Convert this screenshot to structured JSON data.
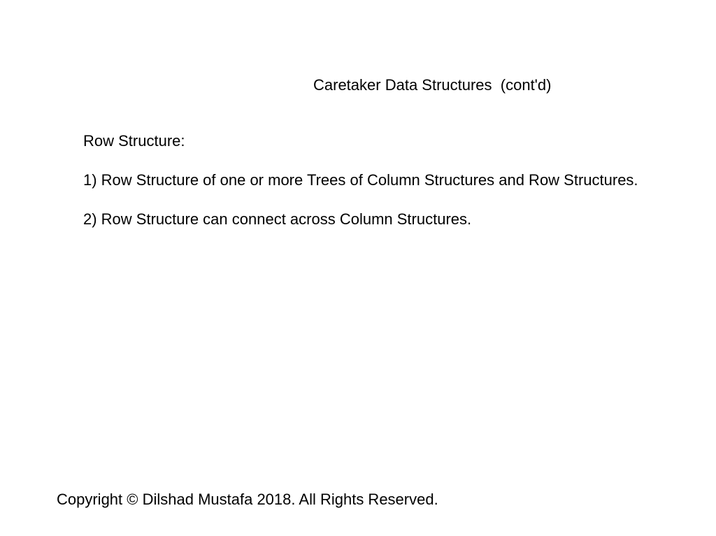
{
  "slide": {
    "title": "Caretaker Data Structures  (cont'd)",
    "section_heading": "Row Structure:",
    "items": [
      "1) Row Structure of one or more Trees of Column Structures and Row Structures.",
      "2) Row Structure can connect across Column Structures."
    ],
    "footer": "Copyright © Dilshad Mustafa 2018. All Rights Reserved."
  }
}
